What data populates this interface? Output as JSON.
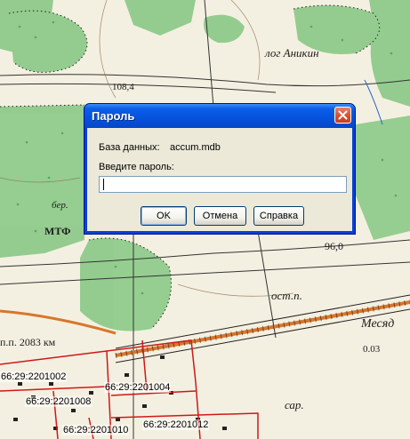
{
  "map": {
    "labels": {
      "anikina": "лог Аникин",
      "height_1": "108,4",
      "height_2": "96,0",
      "berez": "бер.",
      "mtf": "МТФ",
      "ost_p": "ост.п.",
      "mesyad": "Месяд",
      "km": "п.п. 2083 км",
      "depth": "0.03",
      "sar": "сар."
    },
    "parcels": {
      "p1": "66:29:2201002",
      "p2": "66:29:2201004",
      "p3": "66:29:2201008",
      "p4": "66:29:2201010",
      "p5": "66:29:2201012"
    },
    "colors": {
      "forest": "#8ecb8a",
      "background": "#f3efe0",
      "parcel_border": "#d01818",
      "railway": "#d8762c"
    }
  },
  "dialog": {
    "title": "Пароль",
    "close_icon": "close-icon",
    "db_label": "База данных:",
    "db_value": "accum.mdb",
    "prompt": "Введите пароль:",
    "password_value": "",
    "buttons": {
      "ok": "OK",
      "cancel": "Отмена",
      "help": "Справка"
    }
  }
}
